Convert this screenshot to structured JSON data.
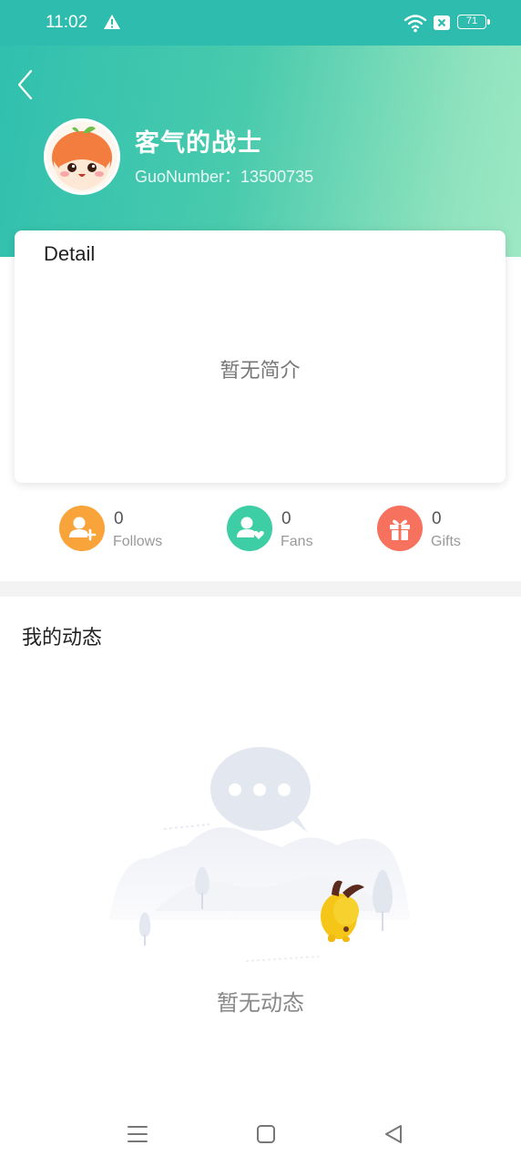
{
  "status_bar": {
    "time": "11:02",
    "battery": "71",
    "icons": [
      "warning-icon",
      "wifi-icon",
      "sim-disabled-icon",
      "battery-icon"
    ]
  },
  "profile": {
    "nickname": "客气的战士",
    "guo_number": "GuoNumber：13500735"
  },
  "detail": {
    "title": "Detail",
    "empty_text": "暂无简介"
  },
  "stats": [
    {
      "count": "0",
      "label": "Follows",
      "icon": "add-user-icon",
      "color": "#f9a43a"
    },
    {
      "count": "0",
      "label": "Fans",
      "icon": "user-heart-icon",
      "color": "#3dcea6"
    },
    {
      "count": "0",
      "label": "Gifts",
      "icon": "gift-icon",
      "color": "#f6725e"
    }
  ],
  "moments": {
    "title": "我的动态",
    "empty_text": "暂无动态"
  },
  "nav_bar": {
    "buttons": [
      "menu-icon",
      "home-icon",
      "back-triangle-icon"
    ]
  },
  "colors": {
    "header_start": "#30c0ae",
    "header_end": "#9de8c5",
    "status_bar": "#2dbcae"
  }
}
